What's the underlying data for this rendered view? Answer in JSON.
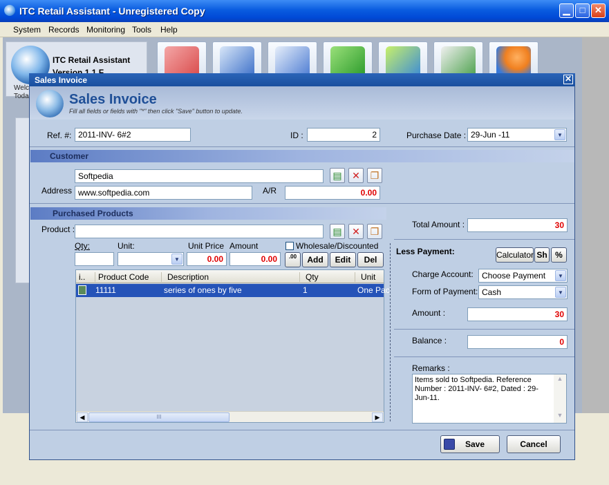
{
  "window": {
    "title": "ITC Retail Assistant - Unregistered Copy"
  },
  "menu": [
    "System",
    "Records",
    "Monitoring",
    "Tools",
    "Help"
  ],
  "left_panel": {
    "title": "ITC Retail Assistant",
    "version": "Version 1.1 F",
    "welcome": "Welc",
    "today": "Toda"
  },
  "dialog": {
    "title": "Sales Invoice",
    "header_title": "Sales Invoice",
    "header_sub": "Fill all fields or fields with \"*\" then click \"Save\" button to update.",
    "ref_label": "Ref. #:",
    "ref_value": "2011-INV- 6#2",
    "id_label": "ID :",
    "id_value": "2",
    "purchase_date_label": "Purchase Date :",
    "purchase_date_value": "29-Jun -11",
    "customer_section": "Customer",
    "customer_name": "Softpedia",
    "address_label": "Address :",
    "address_value": "www.softpedia.com",
    "ar_label": "A/R",
    "ar_value": "0.00",
    "products_section": "Purchased Products",
    "product_label": "Product :",
    "product_value": "",
    "qty_label": "Qty:",
    "unit_label": "Unit:",
    "unit_price_label": "Unit Price",
    "amount_label": "Amount",
    "unit_price_value": "0.00",
    "amount_value": "0.00",
    "wholesale_label": "Wholesale/Discounted",
    "decimal_button": ".00",
    "add_button": "Add",
    "edit_button": "Edit",
    "del_button": "Del",
    "grid_columns": [
      "i..",
      "Product Code",
      "Description",
      "Qty",
      "Unit"
    ],
    "grid_rows": [
      {
        "code": "11111",
        "description": "series of ones by five",
        "qty": "1",
        "unit": "One Pac"
      }
    ],
    "hscroll_grip": "III",
    "total_amount_label": "Total Amount :",
    "total_amount_value": "30",
    "less_payment_label": "Less Payment:",
    "calculator_button": "Calculator",
    "sh_button": "Sh",
    "percent_button": "%",
    "charge_account_label": "Charge Account:",
    "charge_account_value": "Choose Payment",
    "form_of_payment_label": "Form of Payment:",
    "form_of_payment_value": "Cash",
    "amount_pay_label": "Amount :",
    "amount_pay_value": "30",
    "balance_label": "Balance :",
    "balance_value": "0",
    "remarks_label": "Remarks :",
    "remarks_value": "Items sold to Softpedia. Reference Number :  2011-INV- 6#2, Dated : 29-Jun-11.",
    "save_button": "Save",
    "cancel_button": "Cancel"
  }
}
